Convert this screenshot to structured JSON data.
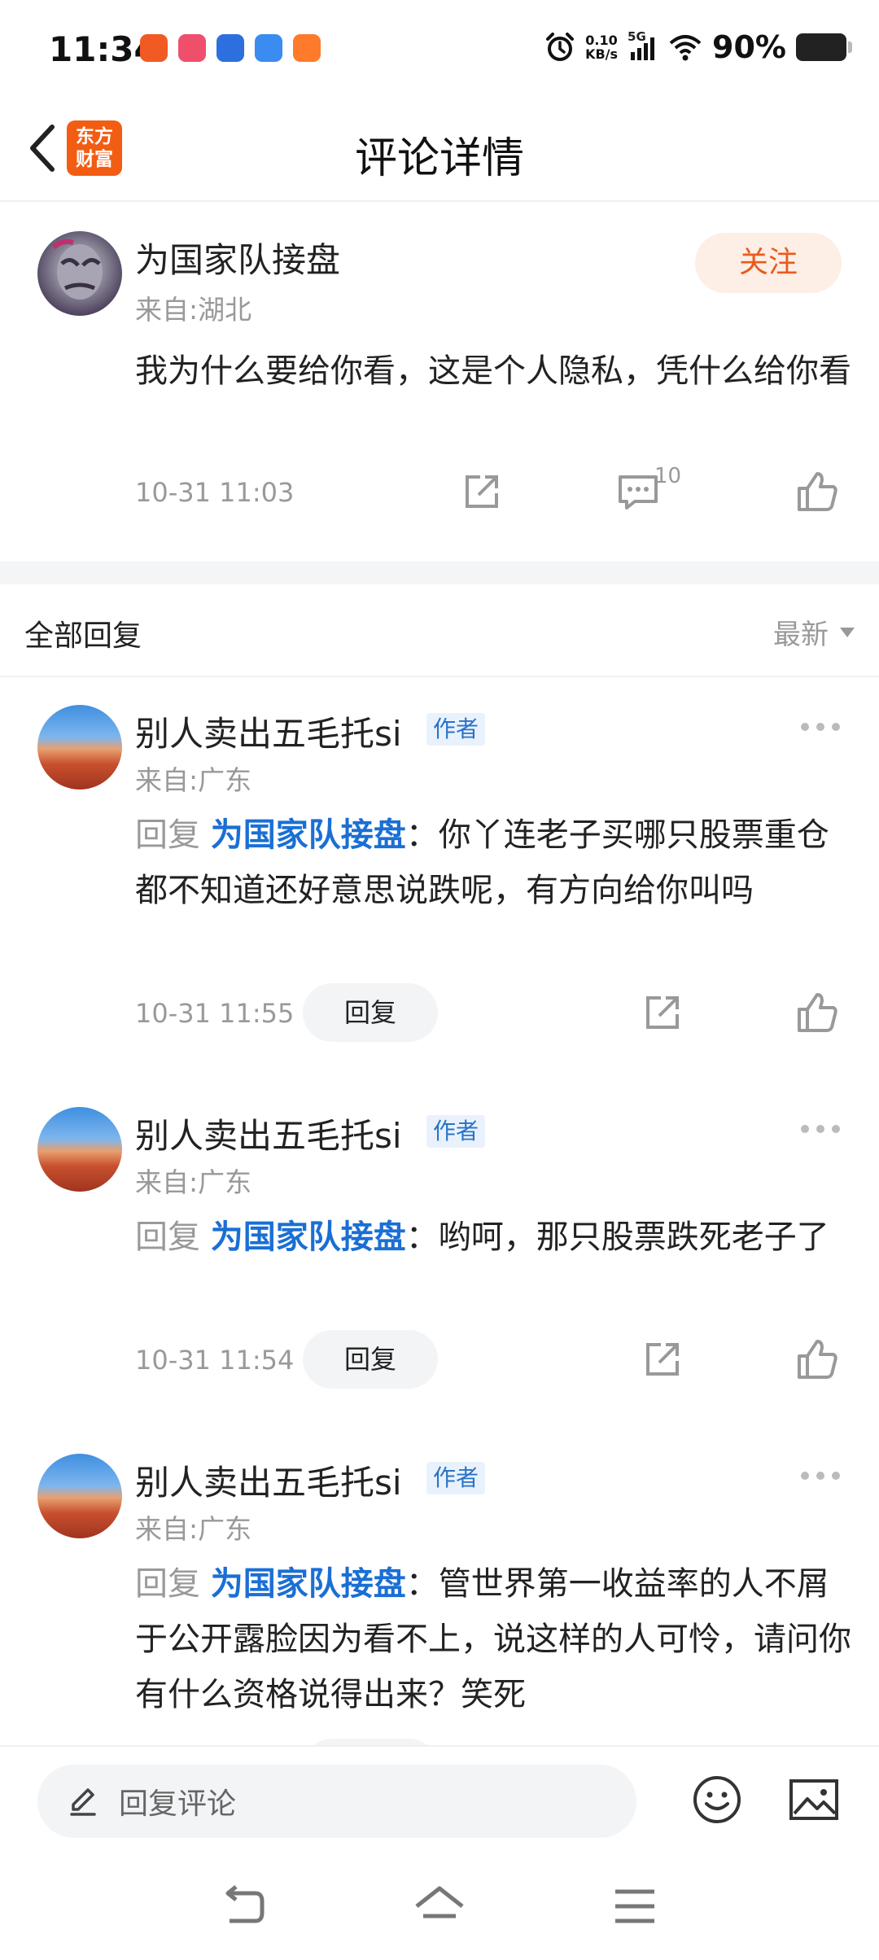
{
  "status_bar": {
    "time": "11:34",
    "net_speed_value": "0.10",
    "net_speed_unit": "KB/s",
    "network": "5G",
    "battery": "90%"
  },
  "header": {
    "logo_line1": "东方",
    "logo_line2": "财富",
    "title": "评论详情"
  },
  "main_comment": {
    "username": "为国家队接盘",
    "location": "来自:湖北",
    "follow_label": "关注",
    "text": "我为什么要给你看，这是个人隐私，凭什么给你看",
    "time": "10-31 11:03",
    "comment_count": "10"
  },
  "replies_section": {
    "title": "全部回复",
    "sort_label": "最新"
  },
  "replies": [
    {
      "username": "别人卖出五毛托si",
      "badge": "作者",
      "location": "来自:广东",
      "prefix": "回复 ",
      "target": "为国家队接盘",
      "text": "：你丫连老子买哪只股票重仓都不知道还好意思说跌呢，有方向给你叫吗",
      "time": "10-31 11:55",
      "reply_label": "回复"
    },
    {
      "username": "别人卖出五毛托si",
      "badge": "作者",
      "location": "来自:广东",
      "prefix": "回复 ",
      "target": "为国家队接盘",
      "text": "：哟呵，那只股票跌死老子了",
      "time": "10-31 11:54",
      "reply_label": "回复"
    },
    {
      "username": "别人卖出五毛托si",
      "badge": "作者",
      "location": "来自:广东",
      "prefix": "回复 ",
      "target": "为国家队接盘",
      "text": "：管世界第一收益率的人不屑于公开露脸因为看不上，说这样的人可怜，请问你有什么资格说得出来？笑死",
      "time": "",
      "reply_label": ""
    }
  ],
  "bottom_bar": {
    "placeholder": "回复评论"
  },
  "icons": {
    "edit": "pencil-icon",
    "emoji": "smiley-icon",
    "image": "image-icon",
    "share": "share-icon",
    "comment": "comment-icon",
    "like": "thumbs-up-icon",
    "back": "chevron-left-icon"
  },
  "colors": {
    "brand": "#f25d13",
    "follow_text": "#ea5a1c",
    "link": "#1a6fd4",
    "badge_text": "#2a73c8"
  }
}
